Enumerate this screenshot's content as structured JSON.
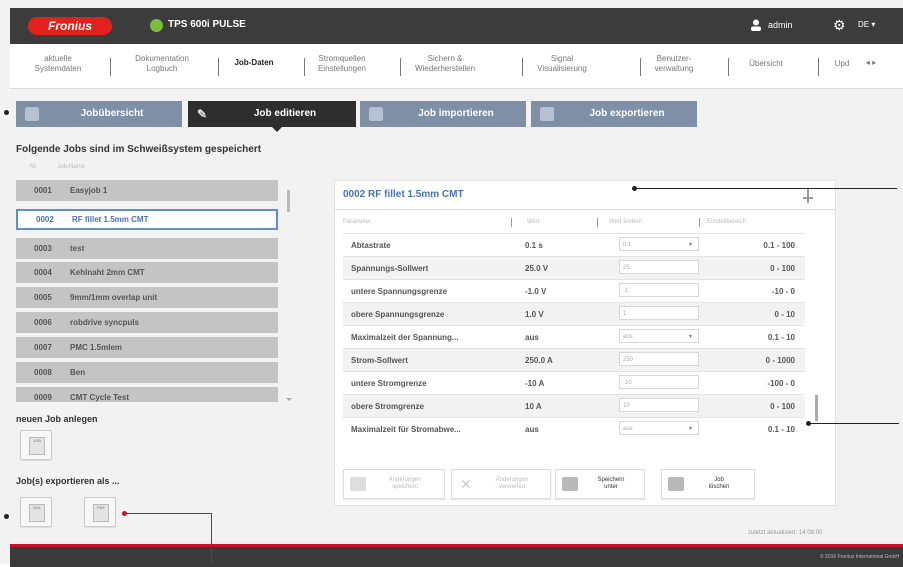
{
  "header": {
    "logo": "Fronius",
    "product": "TPS 600i PULSE",
    "user": "admin",
    "language": "DE"
  },
  "nav": [
    {
      "label": "aktuelle\nSystemdaten"
    },
    {
      "label": "Dokumentation\nLogbuch"
    },
    {
      "label": "Job-Daten"
    },
    {
      "label": "Stromquellen\nEinstellungen"
    },
    {
      "label": "Sichern &\nWiederherstellen"
    },
    {
      "label": "Signal\nVisualisierung"
    },
    {
      "label": "Benutzer-\nverwaltung"
    },
    {
      "label": "Übersicht"
    },
    {
      "label": "Upd"
    }
  ],
  "tabs": {
    "overview": "Jobübersicht",
    "edit": "Job editieren",
    "import": "Job importieren",
    "export": "Job exportieren"
  },
  "section_title": "Folgende Jobs sind im Schweißsystem gespeichert",
  "list_headers": {
    "nr": "Nr.",
    "name": "Job-Name"
  },
  "jobs": [
    {
      "num": "0001",
      "name": "Easyjob 1"
    },
    {
      "num": "0002",
      "name": "RF fillet 1.5mm CMT"
    },
    {
      "num": "0003",
      "name": "test"
    },
    {
      "num": "0004",
      "name": "Kehlnaht 2mm CMT"
    },
    {
      "num": "0005",
      "name": "9mm/1mm overlap unit"
    },
    {
      "num": "0006",
      "name": "robdrive syncpuls"
    },
    {
      "num": "0007",
      "name": "PMC 1.5mlem"
    },
    {
      "num": "0008",
      "name": "Ben"
    },
    {
      "num": "0009",
      "name": "CMT Cycle Test"
    }
  ],
  "new_job_label": "neuen Job anlegen",
  "export_as_label": "Job(s) exportieren als ...",
  "file_icons": {
    "new": "JOB",
    "xml": "XML",
    "pdf": "PDF"
  },
  "detail": {
    "title": "0002 RF fillet 1.5mm CMT",
    "headers": {
      "param": "Parameter",
      "value": "Wert",
      "new_value": "Wert ändern",
      "range": "Einstellbereich"
    },
    "rows": [
      {
        "name": "Abtastrate",
        "value": "0.1 s",
        "input": "0.1",
        "dropdown": true,
        "range": "0.1 - 100"
      },
      {
        "name": "Spannungs-Sollwert",
        "value": "25.0 V",
        "input": "25",
        "dropdown": false,
        "range": "0 - 100"
      },
      {
        "name": "untere Spannungsgrenze",
        "value": "-1.0 V",
        "input": "-1",
        "dropdown": false,
        "range": "-10 - 0"
      },
      {
        "name": "obere Spannungsgrenze",
        "value": "1.0 V",
        "input": "1",
        "dropdown": false,
        "range": "0 - 10"
      },
      {
        "name": "Maximalzeit der Spannung...",
        "value": "aus",
        "input": "aus",
        "dropdown": true,
        "range": "0.1 - 10"
      },
      {
        "name": "Strom-Sollwert",
        "value": "250.0 A",
        "input": "250",
        "dropdown": false,
        "range": "0 - 1000"
      },
      {
        "name": "untere Stromgrenze",
        "value": "-10 A",
        "input": "-10",
        "dropdown": false,
        "range": "-100 - 0"
      },
      {
        "name": "obere Stromgrenze",
        "value": "10 A",
        "input": "10",
        "dropdown": false,
        "range": "0 - 100"
      },
      {
        "name": "Maximalzeit für Stromabwe...",
        "value": "aus",
        "input": "aus",
        "dropdown": true,
        "range": "0.1 - 10"
      }
    ],
    "buttons": {
      "save": "Änderungen\nspeichern",
      "discard": "Änderungen\nverwerfen",
      "save_as": "Speichern\nunter",
      "delete": "Job\nlöschen"
    }
  },
  "footer": {
    "updated": "zuletzt aktualisiert: 14:08:00",
    "copyright": "© 2016 Fronius International GmbH"
  },
  "colors": {
    "brand_red": "#e3211c",
    "tab_blue": "#7f8fa6",
    "link_blue": "#4a72b0",
    "dark": "#3c3c3c"
  }
}
